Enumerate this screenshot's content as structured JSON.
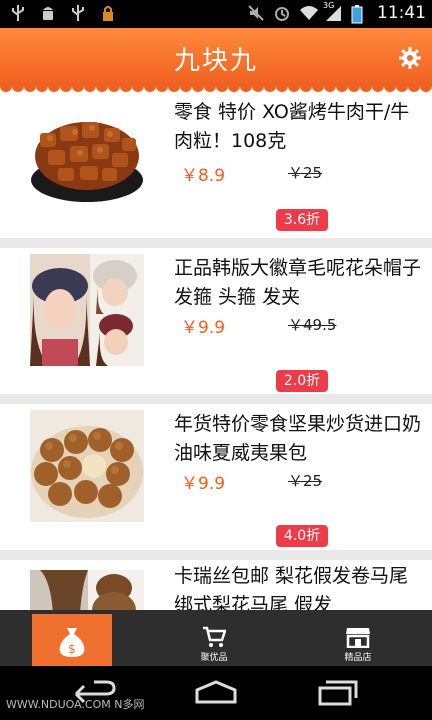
{
  "status_bar": {
    "time": "11:41",
    "network": "3G"
  },
  "header": {
    "title": "九块九"
  },
  "items": [
    {
      "title": "零食 特价 XO酱烤牛肉干/牛肉粒！108克",
      "price": "￥8.9",
      "original_price": "￥25",
      "discount": "3.6折"
    },
    {
      "title": "正品韩版大徽章毛呢花朵帽子 发箍 头箍 发夹",
      "price": "￥9.9",
      "original_price": "￥49.5",
      "discount": "2.0折"
    },
    {
      "title": "年货特价零食坚果炒货进口奶油味夏威夷果包",
      "price": "￥9.9",
      "original_price": "￥25",
      "discount": "4.0折"
    },
    {
      "title": "卡瑞丝包邮 梨花假发卷马尾 绑式梨花马尾 假发"
    }
  ],
  "bottom_nav": {
    "tab1": "",
    "tab2": "聚优品",
    "tab3": "精品店"
  },
  "watermark": "WWW.NDUOA.COM N多网",
  "colors": {
    "accent": "#f06020",
    "price": "#ff5a1a",
    "discount_bg": "#ee3b4a"
  }
}
